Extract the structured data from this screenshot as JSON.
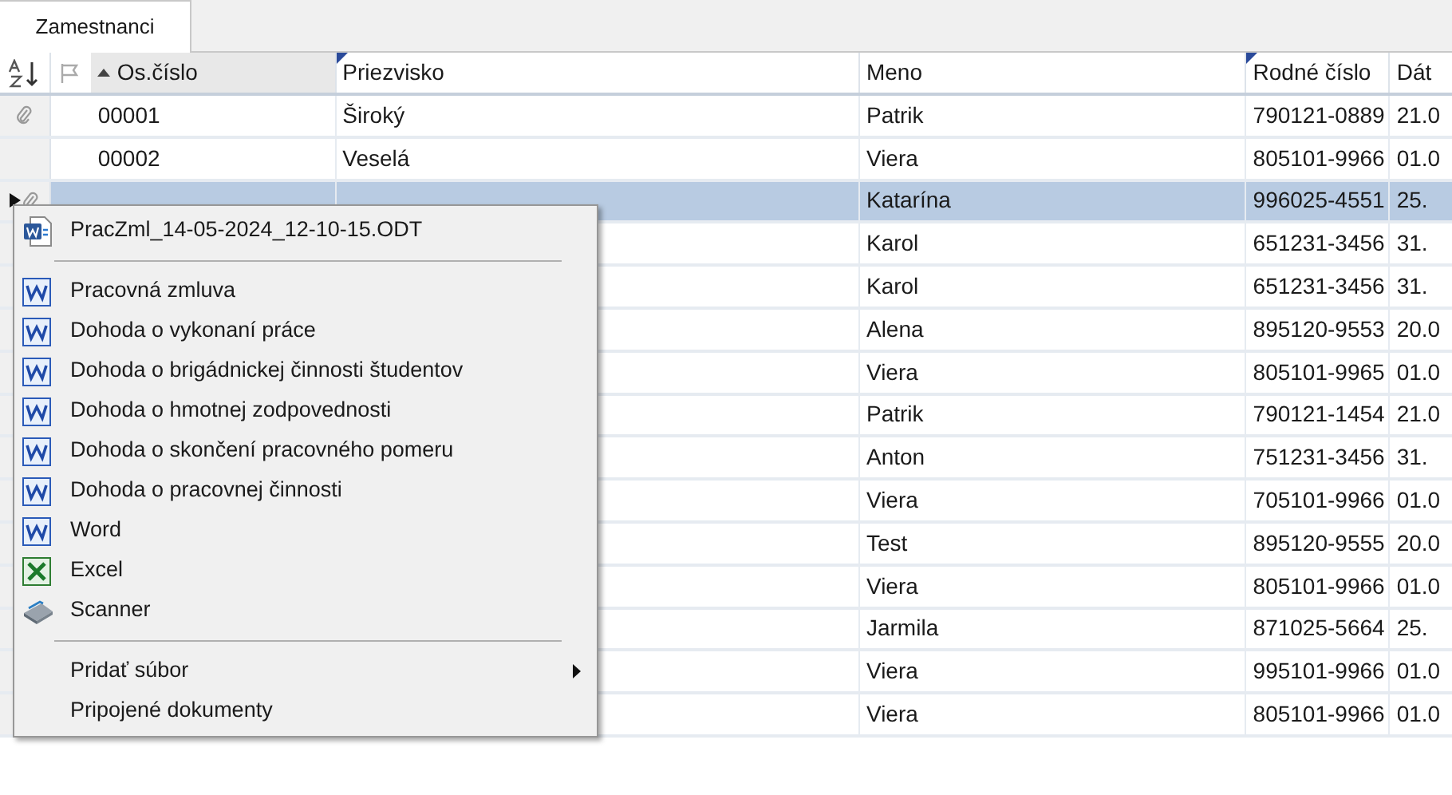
{
  "tabs": [
    {
      "label": "Zamestnanci",
      "selected": true
    }
  ],
  "table": {
    "columns": [
      {
        "label": "Os.číslo",
        "sorted": true,
        "marked": false
      },
      {
        "label": "Priezvisko",
        "sorted": false,
        "marked": true
      },
      {
        "label": "Meno",
        "sorted": false,
        "marked": false
      },
      {
        "label": "Rodné číslo",
        "sorted": false,
        "marked": true
      },
      {
        "label": "Dát",
        "sorted": false,
        "marked": false
      }
    ],
    "rows": [
      {
        "os_cislo": "00001",
        "priezvisko": "Široký",
        "meno": "Patrik",
        "rodne_cislo": "790121-0889",
        "datum": "21.0",
        "selected": false,
        "current": false,
        "attachment": true
      },
      {
        "os_cislo": "00002",
        "priezvisko": "Veselá",
        "meno": "Viera",
        "rodne_cislo": "805101-9966",
        "datum": "01.0",
        "selected": false,
        "current": false,
        "attachment": false
      },
      {
        "meno": "Katarína",
        "rodne_cislo": "996025-4551",
        "datum": "25.",
        "selected": true,
        "current": true,
        "attachment": true
      },
      {
        "meno": "Karol",
        "rodne_cislo": "651231-3456",
        "datum": "31.",
        "selected": false
      },
      {
        "meno": "Karol",
        "rodne_cislo": "651231-3456",
        "datum": "31.",
        "selected": false
      },
      {
        "meno": "Alena",
        "rodne_cislo": "895120-9553",
        "datum": "20.0",
        "selected": false
      },
      {
        "meno": "Viera",
        "rodne_cislo": "805101-9965",
        "datum": "01.0",
        "selected": false
      },
      {
        "meno": "Patrik",
        "rodne_cislo": "790121-1454",
        "datum": "21.0",
        "selected": false
      },
      {
        "meno": "Anton",
        "rodne_cislo": "751231-3456",
        "datum": "31.",
        "selected": false
      },
      {
        "meno": "Viera",
        "rodne_cislo": "705101-9966",
        "datum": "01.0",
        "selected": false
      },
      {
        "meno": "Test",
        "rodne_cislo": "895120-9555",
        "datum": "20.0",
        "selected": false
      },
      {
        "meno": "Viera",
        "rodne_cislo": "805101-9966",
        "datum": "01.0",
        "selected": false
      },
      {
        "meno": "Jarmila",
        "rodne_cislo": "871025-5664",
        "datum": "25.",
        "selected": false
      },
      {
        "meno": "Viera",
        "rodne_cislo": "995101-9966",
        "datum": "01.0",
        "selected": false
      },
      {
        "meno": "Viera",
        "rodne_cislo": "805101-9966",
        "datum": "01.0",
        "selected": false
      }
    ]
  },
  "context_menu": {
    "items": [
      {
        "kind": "file",
        "label": "PracZml_14-05-2024_12-10-15.ODT"
      },
      {
        "kind": "separator"
      },
      {
        "kind": "word",
        "label": "Pracovná zmluva"
      },
      {
        "kind": "word",
        "label": "Dohoda o vykonaní práce"
      },
      {
        "kind": "word",
        "label": "Dohoda o brigádnickej činnosti študentov"
      },
      {
        "kind": "word",
        "label": "Dohoda o hmotnej zodpovednosti"
      },
      {
        "kind": "word",
        "label": "Dohoda o skončení pracovného pomeru"
      },
      {
        "kind": "word",
        "label": "Dohoda o pracovnej činnosti"
      },
      {
        "kind": "word",
        "label": "Word"
      },
      {
        "kind": "excel",
        "label": "Excel"
      },
      {
        "kind": "scanner",
        "label": "Scanner"
      },
      {
        "kind": "separator"
      },
      {
        "kind": "submenu",
        "label": "Pridať súbor"
      },
      {
        "kind": "plain",
        "label": "Pripojené dokumenty"
      }
    ]
  }
}
